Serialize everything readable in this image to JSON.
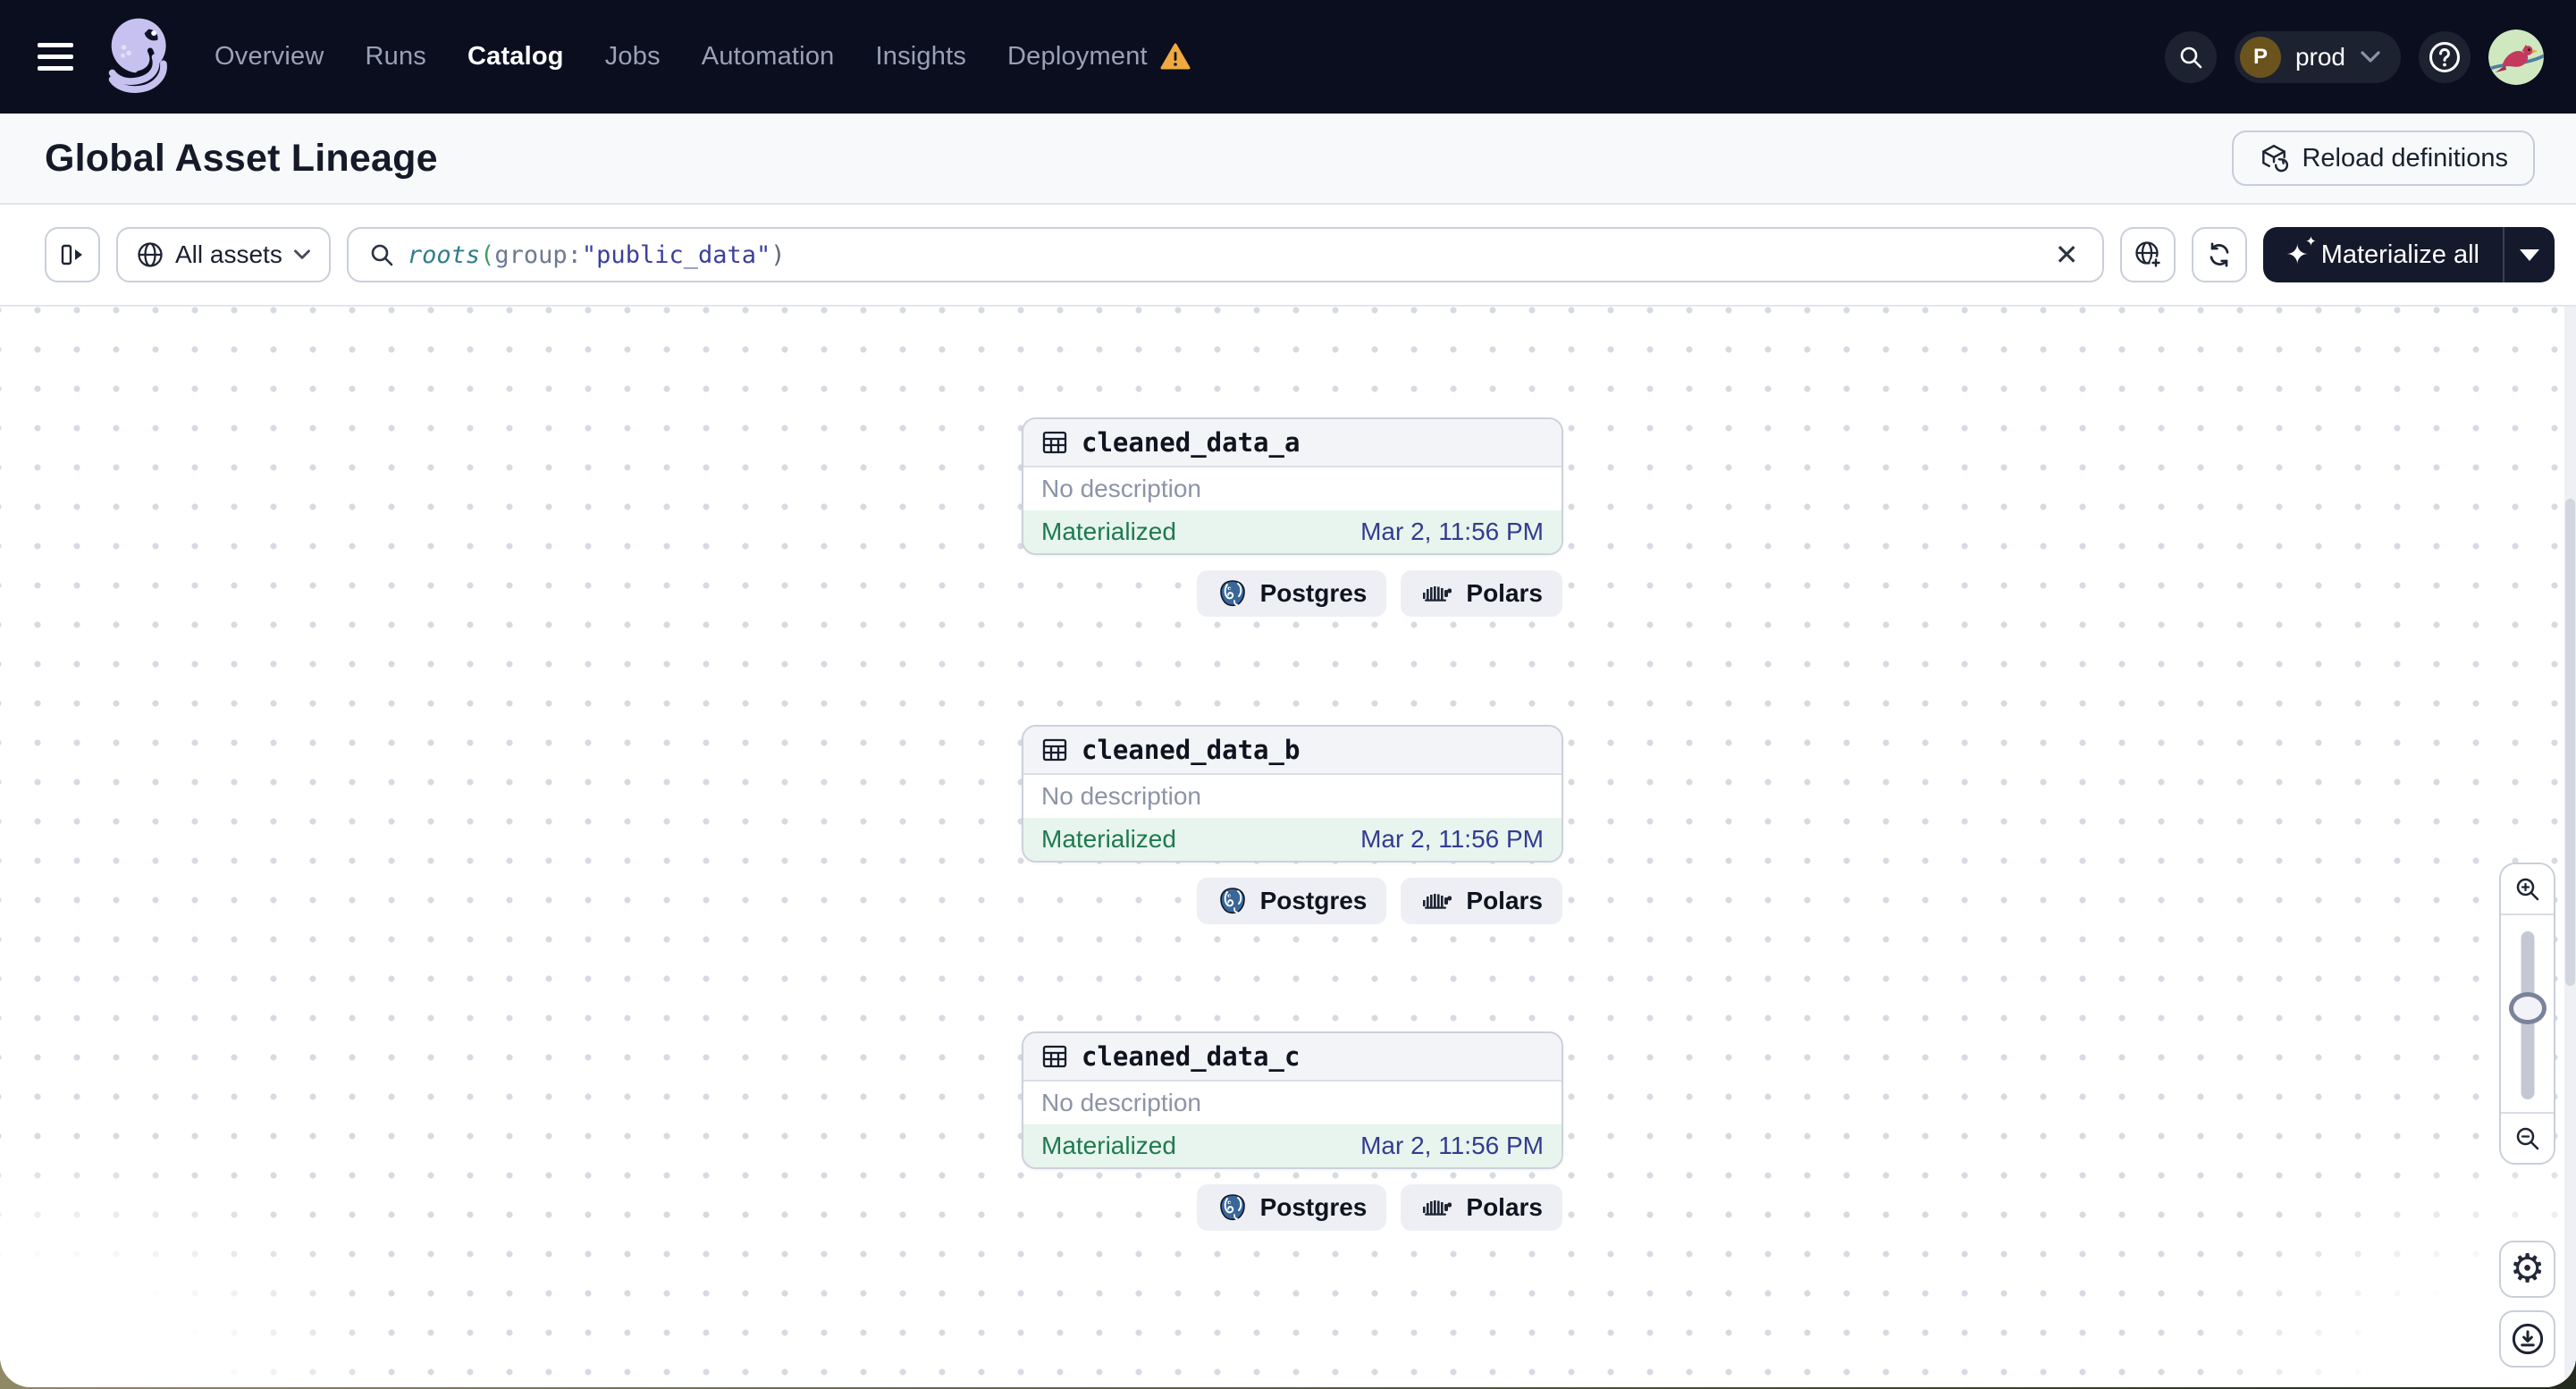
{
  "nav": {
    "items": [
      {
        "label": "Overview",
        "active": false
      },
      {
        "label": "Runs",
        "active": false
      },
      {
        "label": "Catalog",
        "active": true
      },
      {
        "label": "Jobs",
        "active": false
      },
      {
        "label": "Automation",
        "active": false
      },
      {
        "label": "Insights",
        "active": false
      },
      {
        "label": "Deployment",
        "active": false,
        "warning": true
      }
    ],
    "workspace": {
      "initial": "P",
      "label": "prod"
    }
  },
  "header": {
    "title": "Global Asset Lineage",
    "reload_label": "Reload definitions"
  },
  "toolbar": {
    "scope_label": "All assets",
    "query": {
      "tokens": [
        {
          "text": "roots",
          "kind": "function"
        },
        {
          "text": "(",
          "kind": "paren"
        },
        {
          "text": "group",
          "kind": "attribute"
        },
        {
          "text": ":",
          "kind": "colon"
        },
        {
          "text": "\"public_data\"",
          "kind": "string"
        },
        {
          "text": ")",
          "kind": "paren"
        }
      ]
    },
    "materialize_label": "Materialize all"
  },
  "graph": {
    "assets": [
      {
        "name": "cleaned_data_a",
        "description": "No description",
        "status": "Materialized",
        "timestamp": "Mar 2, 11:56 PM",
        "kinds": [
          "Postgres",
          "Polars"
        ]
      },
      {
        "name": "cleaned_data_b",
        "description": "No description",
        "status": "Materialized",
        "timestamp": "Mar 2, 11:56 PM",
        "kinds": [
          "Postgres",
          "Polars"
        ]
      },
      {
        "name": "cleaned_data_c",
        "description": "No description",
        "status": "Materialized",
        "timestamp": "Mar 2, 11:56 PM",
        "kinds": [
          "Postgres",
          "Polars"
        ]
      }
    ]
  },
  "colors": {
    "nav_bg": "#0a0e1e",
    "brand_lavender": "#c6c1ef",
    "warning_amber": "#efa93e",
    "status_green": "#20794f",
    "status_green_bg": "#e7f5ee",
    "timestamp_blue": "#333c90",
    "postgres_blue": "#39679a",
    "dark_button": "#141a2c"
  }
}
